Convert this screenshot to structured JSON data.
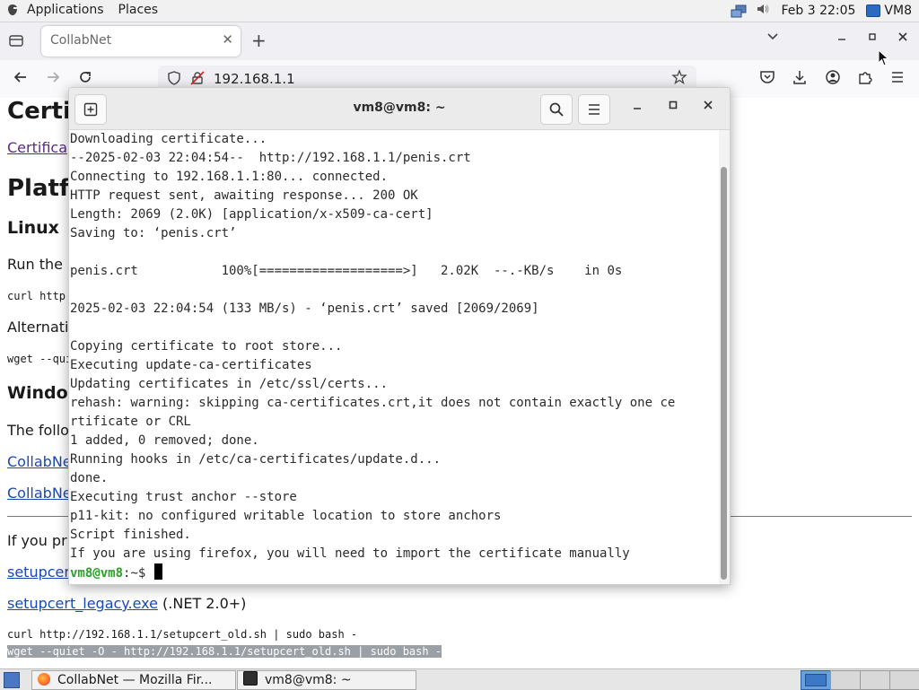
{
  "top_panel": {
    "applications": "Applications",
    "places": "Places",
    "clock": "Feb 3 22:05",
    "vm_label": "VM8"
  },
  "browser": {
    "tab_title": "CollabNet",
    "tab_close": "✕",
    "new_tab": "+",
    "url": "192.168.1.1"
  },
  "page": {
    "h1_title": "Certi",
    "link_certificate": "Certifica",
    "h1_platform": "Platf",
    "h3_linux": "Linux",
    "p_run": "Run the",
    "code_curl": "curl http",
    "p_alternative": "Alternati",
    "code_wget": "wget --qui",
    "h3_windows": "Windo",
    "p_following": "The follo",
    "link_collabnet_1": "CollabNe",
    "link_collabnet_2": "CollabNe",
    "p_if_you": "If you pr",
    "link_setupcert": "setupcer",
    "link_setupcert_legacy": "setupcert_legacy.exe",
    "legacy_note": " (.NET 2.0+)",
    "code_curl_old": "curl http://192.168.1.1/setupcert_old.sh | sudo bash -",
    "code_wget_old": "wget --quiet -O - http://192.168.1.1/setupcert_old.sh | sudo bash -"
  },
  "terminal": {
    "title": "vm8@vm8: ~",
    "lines": [
      "Downloading certificate...",
      "--2025-02-03 22:04:54--  http://192.168.1.1/penis.crt",
      "Connecting to 192.168.1.1:80... connected.",
      "HTTP request sent, awaiting response... 200 OK",
      "Length: 2069 (2.0K) [application/x-x509-ca-cert]",
      "Saving to: ‘penis.crt’",
      "",
      "penis.crt           100%[===================>]   2.02K  --.-KB/s    in 0s",
      "",
      "2025-02-03 22:04:54 (133 MB/s) - ‘penis.crt’ saved [2069/2069]",
      "",
      "Copying certificate to root store...",
      "Executing update-ca-certificates",
      "Updating certificates in /etc/ssl/certs...",
      "rehash: warning: skipping ca-certificates.crt,it does not contain exactly one ce",
      "rtificate or CRL",
      "1 added, 0 removed; done.",
      "Running hooks in /etc/ca-certificates/update.d...",
      "done.",
      "Executing trust anchor --store",
      "p11-kit: no configured writable location to store anchors",
      "Script finished.",
      "If you are using firefox, you will need to import the certificate manually"
    ],
    "prompt_user": "vm8@vm8",
    "prompt_path": ":~$ "
  },
  "taskbar": {
    "firefox_item": "CollabNet — Mozilla Fir...",
    "terminal_item": "vm8@vm8: ~"
  },
  "colors": {
    "prompt_green": "#2aa12a",
    "link_blue": "#1a49b5",
    "link_visited": "#5b2a86",
    "selection_gray": "#9aa0a6"
  }
}
